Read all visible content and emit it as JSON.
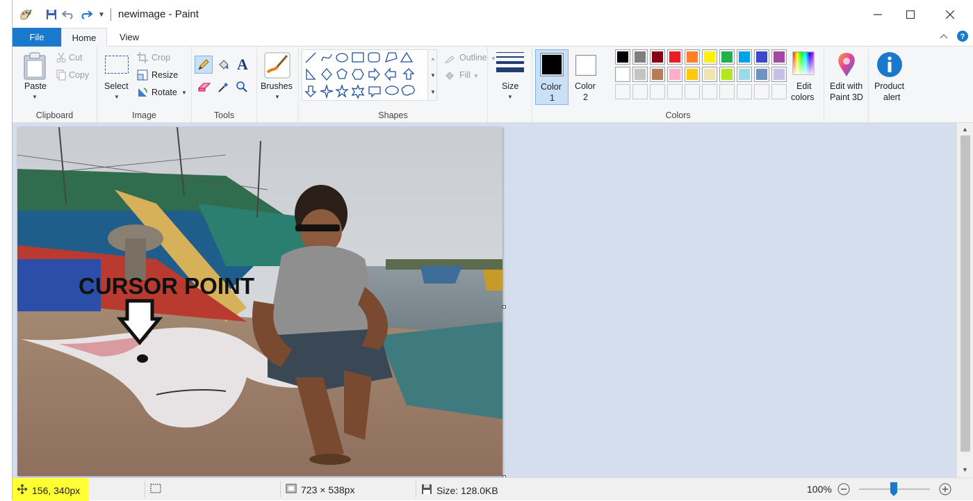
{
  "window": {
    "title": "newimage - Paint"
  },
  "tabs": {
    "file": "File",
    "home": "Home",
    "view": "View"
  },
  "ribbon": {
    "clipboard": {
      "paste": "Paste",
      "cut": "Cut",
      "copy": "Copy",
      "label": "Clipboard"
    },
    "image": {
      "select": "Select",
      "crop": "Crop",
      "resize": "Resize",
      "rotate": "Rotate",
      "label": "Image"
    },
    "tools": {
      "label": "Tools"
    },
    "brushes": {
      "label": "Brushes"
    },
    "shapes": {
      "outline": "Outline",
      "fill": "Fill",
      "label": "Shapes"
    },
    "size": {
      "label": "Size"
    },
    "colors": {
      "color1_line1": "Color",
      "color1_line2": "1",
      "color2_line1": "Color",
      "color2_line2": "2",
      "edit_line1": "Edit",
      "edit_line2": "colors",
      "label": "Colors",
      "color1_value": "#000000",
      "color2_value": "#ffffff",
      "palette_row1": [
        "#000000",
        "#7f7f7f",
        "#880015",
        "#ed1c24",
        "#ff7f27",
        "#fff200",
        "#22b14c",
        "#00a2e8",
        "#3f48cc",
        "#a349a4"
      ],
      "palette_row2": [
        "#ffffff",
        "#c3c3c3",
        "#b97a57",
        "#ffaec9",
        "#ffc90e",
        "#efe4b0",
        "#b5e61d",
        "#99d9ea",
        "#7092be",
        "#c8bfe7"
      ]
    },
    "paint3d": {
      "line1": "Edit with",
      "line2": "Paint 3D"
    },
    "alert": {
      "line1": "Product",
      "line2": "alert"
    }
  },
  "canvas": {
    "annotation": "CURSOR POINT"
  },
  "status": {
    "cursor_pos": "156, 340px",
    "dimensions": "723 × 538px",
    "size": "Size: 128.0KB",
    "zoom": "100%"
  }
}
